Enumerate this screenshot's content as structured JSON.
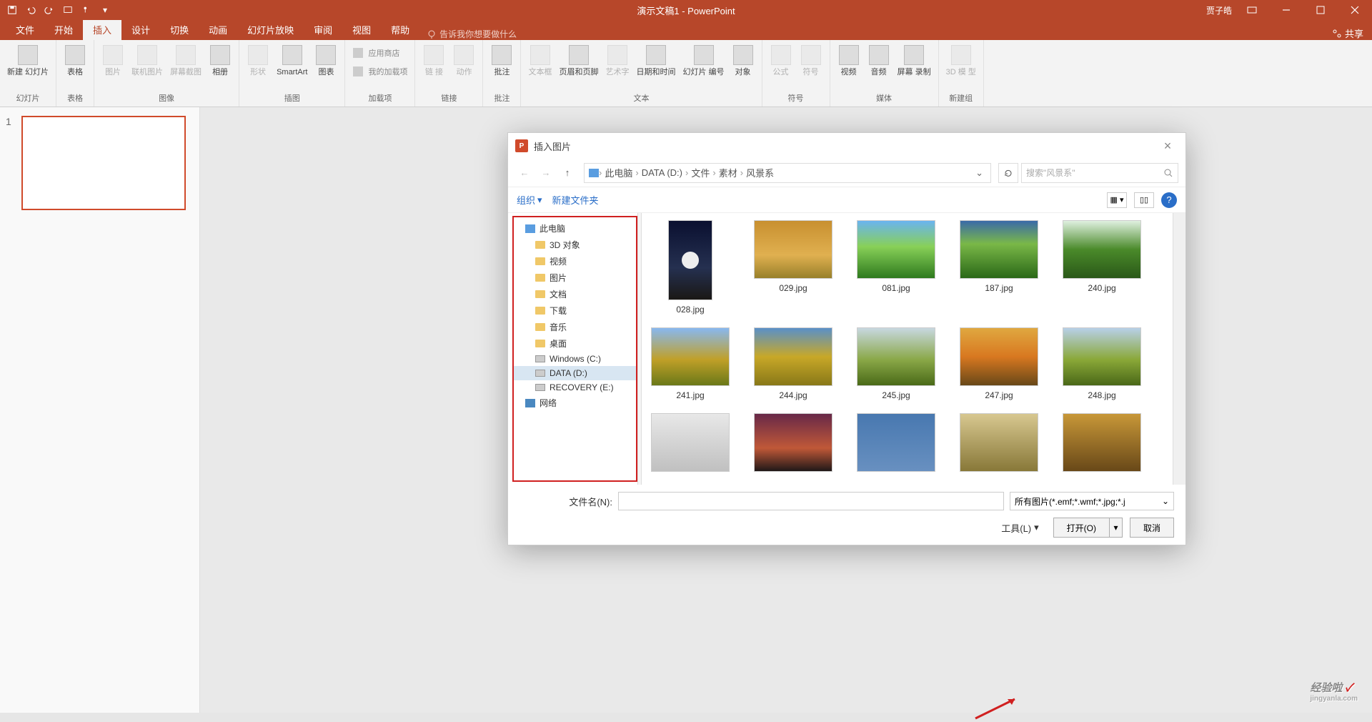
{
  "app": {
    "title": "演示文稿1 - PowerPoint",
    "user": "贾子皓",
    "share": "共享"
  },
  "tabs": {
    "file": "文件",
    "home": "开始",
    "insert": "插入",
    "design": "设计",
    "transition": "切换",
    "animation": "动画",
    "slideshow": "幻灯片放映",
    "review": "审阅",
    "view": "视图",
    "help": "帮助",
    "tellme": "告诉我你想要做什么"
  },
  "ribbon": {
    "groups": {
      "slides": {
        "label": "幻灯片",
        "newslide": "新建\n幻灯片"
      },
      "tables": {
        "label": "表格",
        "table": "表格"
      },
      "images": {
        "label": "图像",
        "picture": "图片",
        "online": "联机图片",
        "screenshot": "屏幕截图",
        "album": "相册"
      },
      "illus": {
        "label": "插图",
        "shapes": "形状",
        "smartart": "SmartArt",
        "chart": "图表"
      },
      "addins": {
        "label": "加载项",
        "store": "应用商店",
        "myaddins": "我的加载项"
      },
      "links": {
        "label": "链接",
        "link": "链\n接",
        "action": "动作"
      },
      "comments": {
        "label": "批注",
        "comment": "批注"
      },
      "text": {
        "label": "文本",
        "textbox": "文本框",
        "headerfooter": "页眉和页脚",
        "wordart": "艺术字",
        "datetime": "日期和时间",
        "slideno": "幻灯片\n编号",
        "object": "对象"
      },
      "symbols": {
        "label": "符号",
        "equation": "公式",
        "symbol": "符号"
      },
      "media": {
        "label": "媒体",
        "video": "视频",
        "audio": "音频",
        "screenrec": "屏幕\n录制"
      },
      "new": {
        "label": "新建组",
        "model3d": "3D 模\n型"
      }
    }
  },
  "slidepanel": {
    "num1": "1"
  },
  "dialog": {
    "title": "插入图片",
    "breadcrumb": {
      "pc": "此电脑",
      "drive": "DATA (D:)",
      "folder1": "文件",
      "folder2": "素材",
      "folder3": "风景系"
    },
    "searchPlaceholder": "搜索\"风景系\"",
    "organize": "组织",
    "newfolder": "新建文件夹",
    "tree": {
      "pc": "此电脑",
      "obj3d": "3D 对象",
      "video": "视频",
      "pictures": "图片",
      "docs": "文档",
      "downloads": "下载",
      "music": "音乐",
      "desktop": "桌面",
      "cdrive": "Windows (C:)",
      "ddrive": "DATA (D:)",
      "edrive": "RECOVERY (E:)",
      "network": "网络"
    },
    "files": [
      {
        "name": "028.jpg",
        "cls": "g1 tall"
      },
      {
        "name": "029.jpg",
        "cls": "g2"
      },
      {
        "name": "081.jpg",
        "cls": "g3"
      },
      {
        "name": "187.jpg",
        "cls": "g4"
      },
      {
        "name": "240.jpg",
        "cls": "g5"
      },
      {
        "name": "241.jpg",
        "cls": "g6"
      },
      {
        "name": "244.jpg",
        "cls": "g7"
      },
      {
        "name": "245.jpg",
        "cls": "g8"
      },
      {
        "name": "247.jpg",
        "cls": "g9"
      },
      {
        "name": "248.jpg",
        "cls": "g10"
      },
      {
        "name": "",
        "cls": "g11"
      },
      {
        "name": "",
        "cls": "g12"
      },
      {
        "name": "",
        "cls": "g13"
      },
      {
        "name": "",
        "cls": "g14"
      },
      {
        "name": "",
        "cls": "g15"
      }
    ],
    "filenameLabel": "文件名(N):",
    "filter": "所有图片(*.emf;*.wmf;*.jpg;*.j",
    "tools": "工具(L)",
    "open": "打开(O)",
    "cancel": "取消"
  },
  "watermark": {
    "main": "经验啦",
    "sub": "jingyanla.com"
  }
}
